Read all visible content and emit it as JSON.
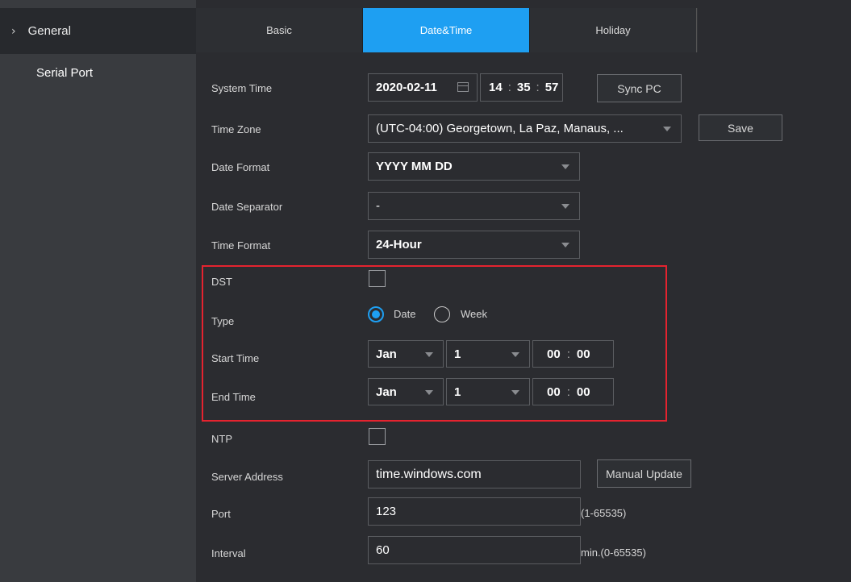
{
  "sidebar": {
    "items": [
      {
        "label": "General",
        "icon": "chevron-right-icon"
      },
      {
        "label": "Serial Port"
      }
    ]
  },
  "tabs": [
    {
      "label": "Basic",
      "active": false
    },
    {
      "label": "Date&Time",
      "active": true
    },
    {
      "label": "Holiday",
      "active": false
    }
  ],
  "form": {
    "system_time": {
      "label": "System Time",
      "date": "2020-02-11",
      "hour": "14",
      "minute": "35",
      "second": "57",
      "sync_label": "Sync PC",
      "calendar_icon": "calendar-icon"
    },
    "time_zone": {
      "label": "Time Zone",
      "value": "(UTC-04:00) Georgetown, La Paz, Manaus, ...",
      "save_label": "Save"
    },
    "date_format": {
      "label": "Date Format",
      "value": "YYYY MM DD"
    },
    "date_separator": {
      "label": "Date Separator",
      "value": "-"
    },
    "time_format": {
      "label": "Time Format",
      "value": "24-Hour"
    },
    "dst": {
      "label": "DST",
      "checked": false
    },
    "type": {
      "label": "Type",
      "options": [
        "Date",
        "Week"
      ],
      "selected": "Date"
    },
    "start_time": {
      "label": "Start Time",
      "month": "Jan",
      "day": "1",
      "hour": "00",
      "minute": "00"
    },
    "end_time": {
      "label": "End Time",
      "month": "Jan",
      "day": "1",
      "hour": "00",
      "minute": "00"
    },
    "ntp": {
      "label": "NTP",
      "checked": false
    },
    "server_address": {
      "label": "Server Address",
      "value": "time.windows.com",
      "manual_update_label": "Manual Update"
    },
    "port": {
      "label": "Port",
      "value": "123",
      "hint": "(1-65535)"
    },
    "interval": {
      "label": "Interval",
      "value": "60",
      "hint": "min.(0-65535)"
    }
  },
  "colors": {
    "accent": "#1e9ff2",
    "highlight_frame": "#e5232f"
  }
}
